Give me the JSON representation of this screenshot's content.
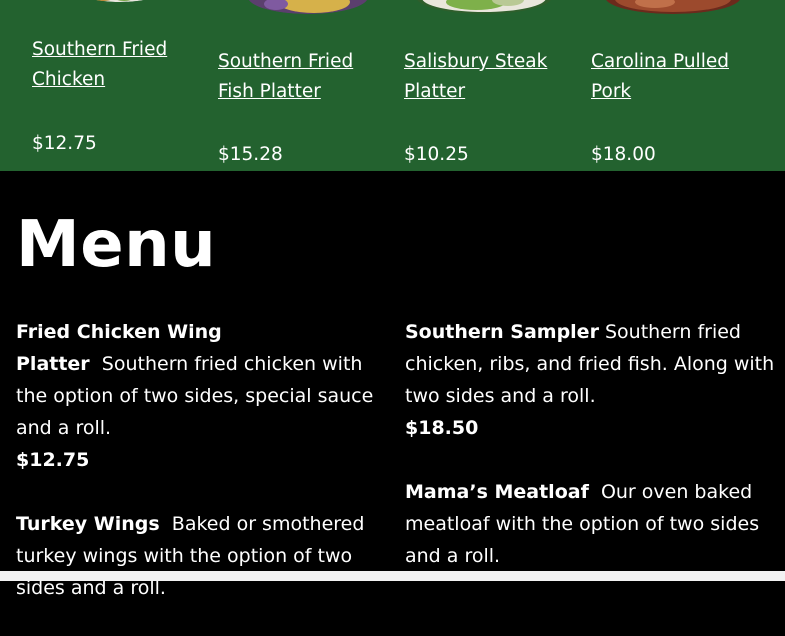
{
  "products": [
    {
      "name": "Southern Fried Chicken",
      "price": "$12.75",
      "image": "fried-chicken-photo"
    },
    {
      "name": "Southern Fried Fish Platter",
      "price": "$15.28",
      "image": "fish-platter-photo"
    },
    {
      "name": "Salisbury Steak Platter",
      "price": "$10.25",
      "image": "salisbury-steak-photo"
    },
    {
      "name": "Carolina Pulled Pork",
      "price": "$18.00",
      "image": "pulled-pork-photo"
    }
  ],
  "menu": {
    "title": "Menu",
    "left": [
      {
        "name": "Fried Chicken Wing Platter",
        "description": "Southern fried chicken with the option of two sides, special sauce and a roll.",
        "price": "$12.75"
      },
      {
        "name": "Turkey Wings",
        "description": "Baked or smothered turkey wings with the option of two sides and a roll.",
        "price": ""
      }
    ],
    "right": [
      {
        "name": "Southern Sampler",
        "description": "Southern fried chicken, ribs, and fried fish. Along with two sides and a roll.",
        "price": "$18.50"
      },
      {
        "name": "Mama’s Meatloaf",
        "description": "Our oven baked meatloaf with the option of two sides and a roll.",
        "price": ""
      }
    ]
  },
  "colors": {
    "product_band": "#23622f",
    "page_background": "#000000",
    "text": "#ffffff"
  }
}
